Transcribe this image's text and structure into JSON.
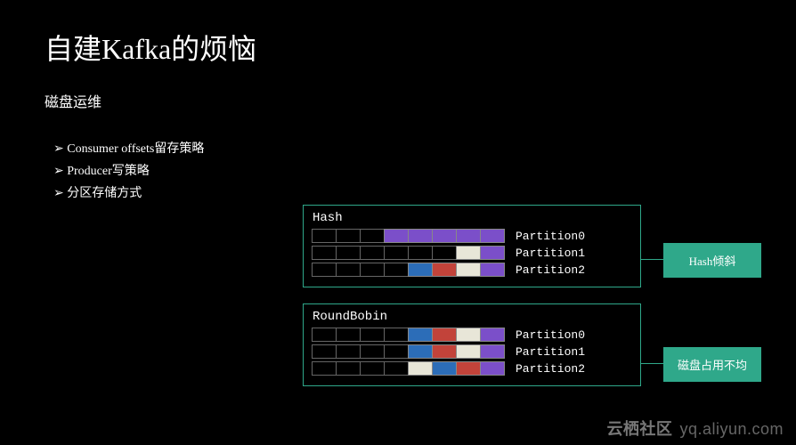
{
  "title": "自建Kafka的烦恼",
  "subtitle": "磁盘运维",
  "bullets": [
    "Consumer offsets留存策略",
    "Producer写策略",
    "分区存储方式"
  ],
  "sections": [
    {
      "label": "Hash",
      "rows": [
        {
          "cells": [
            "empty",
            "empty",
            "empty",
            "purple",
            "purple",
            "purple",
            "purple",
            "purple"
          ],
          "plabel": "Partition0"
        },
        {
          "cells": [
            "empty",
            "empty",
            "empty",
            "empty",
            "empty",
            "empty",
            "white",
            "purple"
          ],
          "plabel": "Partition1"
        },
        {
          "cells": [
            "empty",
            "empty",
            "empty",
            "empty",
            "blue",
            "red",
            "white",
            "purple"
          ],
          "plabel": "Partition2"
        }
      ],
      "tag": "Hash倾斜"
    },
    {
      "label": "RoundBobin",
      "rows": [
        {
          "cells": [
            "empty",
            "empty",
            "empty",
            "empty",
            "blue",
            "red",
            "white",
            "purple"
          ],
          "plabel": "Partition0"
        },
        {
          "cells": [
            "empty",
            "empty",
            "empty",
            "empty",
            "blue",
            "red",
            "white",
            "purple"
          ],
          "plabel": "Partition1"
        },
        {
          "cells": [
            "empty",
            "empty",
            "empty",
            "empty",
            "white",
            "blue",
            "red",
            "purple"
          ],
          "plabel": "Partition2"
        }
      ],
      "tag": "磁盘占用不均"
    }
  ],
  "watermark": {
    "cn": "云栖社区",
    "url": "yq.aliyun.com"
  }
}
